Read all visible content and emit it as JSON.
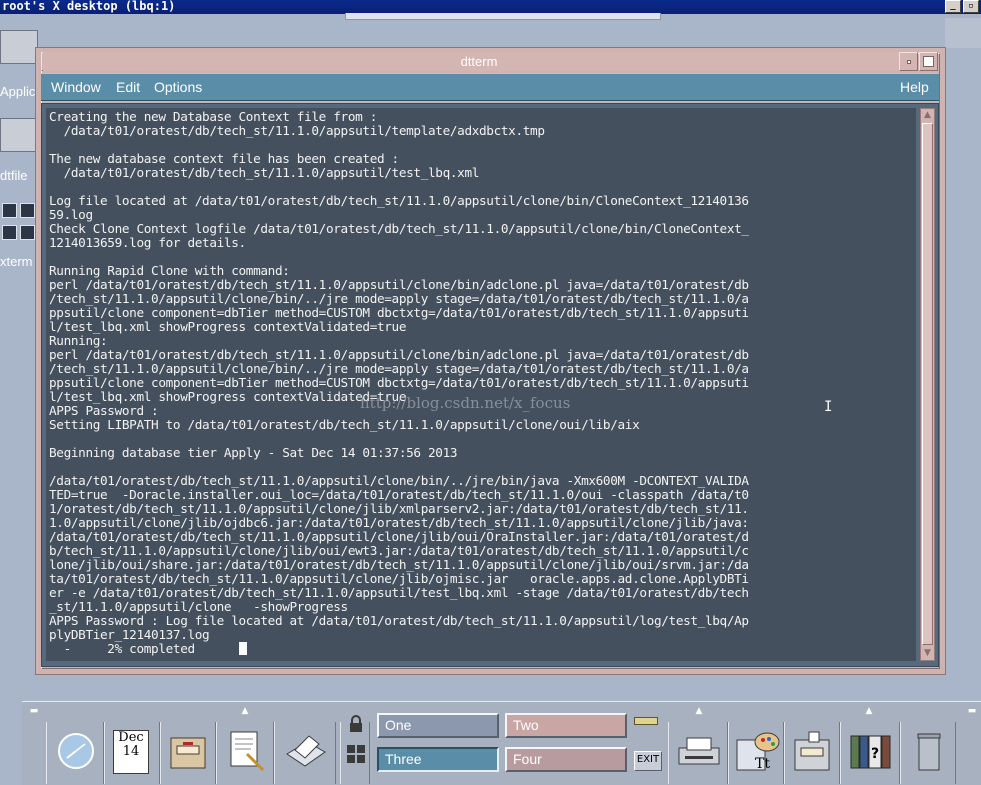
{
  "root": {
    "title": "root's X desktop (lbq:1)",
    "minimize_glyph": "_",
    "restore_glyph": "▫"
  },
  "desktop": {
    "icons": [
      {
        "label": "Applic"
      },
      {
        "label": "dtfile"
      },
      {
        "label": "xterm"
      }
    ]
  },
  "window": {
    "title": "dtterm",
    "menu": {
      "window": "Window",
      "edit": "Edit",
      "options": "Options",
      "help": "Help"
    }
  },
  "terminal": {
    "lines": [
      "Creating the new Database Context file from :",
      "  /data/t01/oratest/db/tech_st/11.1.0/appsutil/template/adxdbctx.tmp",
      "",
      "The new database context file has been created :",
      "  /data/t01/oratest/db/tech_st/11.1.0/appsutil/test_lbq.xml",
      "",
      "Log file located at /data/t01/oratest/db/tech_st/11.1.0/appsutil/clone/bin/CloneContext_12140136",
      "59.log",
      "Check Clone Context logfile /data/t01/oratest/db/tech_st/11.1.0/appsutil/clone/bin/CloneContext_",
      "1214013659.log for details.",
      "",
      "Running Rapid Clone with command:",
      "perl /data/t01/oratest/db/tech_st/11.1.0/appsutil/clone/bin/adclone.pl java=/data/t01/oratest/db",
      "/tech_st/11.1.0/appsutil/clone/bin/../jre mode=apply stage=/data/t01/oratest/db/tech_st/11.1.0/a",
      "ppsutil/clone component=dbTier method=CUSTOM dbctxtg=/data/t01/oratest/db/tech_st/11.1.0/appsuti",
      "l/test_lbq.xml showProgress contextValidated=true",
      "Running:",
      "perl /data/t01/oratest/db/tech_st/11.1.0/appsutil/clone/bin/adclone.pl java=/data/t01/oratest/db",
      "/tech_st/11.1.0/appsutil/clone/bin/../jre mode=apply stage=/data/t01/oratest/db/tech_st/11.1.0/a",
      "ppsutil/clone component=dbTier method=CUSTOM dbctxtg=/data/t01/oratest/db/tech_st/11.1.0/appsuti",
      "l/test_lbq.xml showProgress contextValidated=true",
      "APPS Password :",
      "Setting LIBPATH to /data/t01/oratest/db/tech_st/11.1.0/appsutil/clone/oui/lib/aix",
      "",
      "Beginning database tier Apply - Sat Dec 14 01:37:56 2013",
      "",
      "/data/t01/oratest/db/tech_st/11.1.0/appsutil/clone/bin/../jre/bin/java -Xmx600M -DCONTEXT_VALIDA",
      "TED=true  -Doracle.installer.oui_loc=/data/t01/oratest/db/tech_st/11.1.0/oui -classpath /data/t0",
      "1/oratest/db/tech_st/11.1.0/appsutil/clone/jlib/xmlparserv2.jar:/data/t01/oratest/db/tech_st/11.",
      "1.0/appsutil/clone/jlib/ojdbc6.jar:/data/t01/oratest/db/tech_st/11.1.0/appsutil/clone/jlib/java:",
      "/data/t01/oratest/db/tech_st/11.1.0/appsutil/clone/jlib/oui/OraInstaller.jar:/data/t01/oratest/d",
      "b/tech_st/11.1.0/appsutil/clone/jlib/oui/ewt3.jar:/data/t01/oratest/db/tech_st/11.1.0/appsutil/c",
      "lone/jlib/oui/share.jar:/data/t01/oratest/db/tech_st/11.1.0/appsutil/clone/jlib/oui/srvm.jar:/da",
      "ta/t01/oratest/db/tech_st/11.1.0/appsutil/clone/jlib/ojmisc.jar   oracle.apps.ad.clone.ApplyDBTi",
      "er -e /data/t01/oratest/db/tech_st/11.1.0/appsutil/test_lbq.xml -stage /data/t01/oratest/db/tech",
      "_st/11.1.0/appsutil/clone   -showProgress",
      "APPS Password : Log file located at /data/t01/oratest/db/tech_st/11.1.0/appsutil/log/test_lbq/Ap",
      "plyDBTier_12140137.log"
    ],
    "progress_line": "  -     2% completed      ",
    "watermark": "http://blog.csdn.net/x_focus",
    "ibeam": "I"
  },
  "front_panel": {
    "date": {
      "month": "Dec",
      "day": "14"
    },
    "workspaces": [
      {
        "label": "One",
        "color": "#8c98ad"
      },
      {
        "label": "Two",
        "color": "#c9a6a4"
      },
      {
        "label": "Three",
        "color": "#5a8ea8"
      },
      {
        "label": "Four",
        "color": "#b79b9e"
      }
    ],
    "exit_label": "EXIT",
    "arrow_up": "▲"
  },
  "colors": {
    "terminal_bg": "#44505d",
    "menubar": "#5a8ea8",
    "frame": "#cfb3b0",
    "desktop": "#a9b5c9"
  }
}
